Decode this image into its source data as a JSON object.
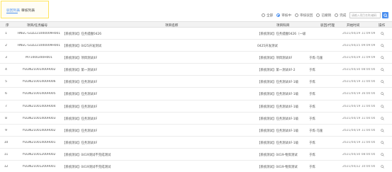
{
  "tabs": [
    {
      "label": "驳回列表",
      "active": true
    },
    {
      "label": "审核列表",
      "active": false
    }
  ],
  "filters": [
    {
      "label": "全部",
      "checked": false
    },
    {
      "label": "审核中",
      "checked": true
    },
    {
      "label": "审核驳回",
      "checked": false
    },
    {
      "label": "已撤销",
      "checked": false
    },
    {
      "label": "完成",
      "checked": false
    }
  ],
  "search": {
    "placeholder": "请输入项目名称/编码"
  },
  "table": {
    "headers": {
      "index": "序",
      "code": "项目/任务编号",
      "name": "项目名称",
      "subject": "项目科目",
      "model": "驳回/代理",
      "time": "开始时间",
      "op": "操作"
    },
    "rows": [
      {
        "idx": "1",
        "code": "HNEC-GLD221000009H001",
        "name": "【系统测试】任务提醒0426",
        "subject": "【系统测试】任务提醒0426（一级项）",
        "model": "",
        "time": "2021/04/29 11:09:09"
      },
      {
        "idx": "2",
        "code": "HNEC-GLD221000009H001",
        "name": "【系统测试】0425开发测试",
        "subject": "0425开发测试",
        "model": "",
        "time": "2021/04/25 09:09:09"
      },
      {
        "idx": "3",
        "code": "M71000200H001",
        "name": "【系统测试】项目测试4F",
        "subject": "【系统测试】项目测试4F",
        "model": "于炼-马施",
        "time": "2021/04/29 11:09:09"
      },
      {
        "idx": "4",
        "code": "YULIN21001400H002",
        "name": "【系统测试】第一测试4F",
        "subject": "【系统测试】第一测试4F-2",
        "model": "于炼",
        "time": "2021/04/30 08:00:00"
      },
      {
        "idx": "5",
        "code": "YULIN21001400H006",
        "name": "【系统测试】任务测试4F",
        "subject": "【系统测试】任务测试4F-1级",
        "model": "于炼",
        "time": "2021/04/19 11:00:00"
      },
      {
        "idx": "6",
        "code": "YULIN21001400H005",
        "name": "【系统测试】任务测试4F",
        "subject": "【系统测试】任务测试4F-1级",
        "model": "于炼",
        "time": "2021/04/19 16:00:00"
      },
      {
        "idx": "7",
        "code": "YULIN21001400H004",
        "name": "【系统测试】任务测试4F",
        "subject": "【系统测试】任务测试4F-1级",
        "model": "于炼",
        "time": "2021/04/19 11:00:00"
      },
      {
        "idx": "8",
        "code": "YULIN21001400H003",
        "name": "【系统测试】任务测试4F",
        "subject": "【系统测试】任务测试4F-1级",
        "model": "于炼",
        "time": "2021/04/19 11:00:00"
      },
      {
        "idx": "9",
        "code": "YULIN21001400H002",
        "name": "【系统测试】任务测试4F",
        "subject": "【系统测试】任务测试4F-1级",
        "model": "于炼-马施",
        "time": "2021/04/19 11:00:00"
      },
      {
        "idx": "10",
        "code": "YULIN21001400H001",
        "name": "【系统测试】任务测试4F",
        "subject": "【系统测试】任务测试4F-1级",
        "model": "于炼",
        "time": "2021/04/19 11:00:00"
      },
      {
        "idx": "11",
        "code": "YULIN21001200H002",
        "name": "【系统测试】0419测试不完成测试",
        "subject": "【系统测试】0419-物资测试",
        "model": "于炼",
        "time": "2021/04/30 08:00:00"
      },
      {
        "idx": "12",
        "code": "YULIN21001200H001",
        "name": "【系统测试】0419测试不完成测试",
        "subject": "【系统测试】0419-物资测试",
        "model": "于炼",
        "time": "2021/04/22 10:00:00"
      }
    ]
  },
  "colors": {
    "accent": "#4a8ff0",
    "highlight_border": "#ffe45c"
  },
  "icons": {
    "search_button": "search-icon",
    "row_action": "magnifier-icon"
  }
}
